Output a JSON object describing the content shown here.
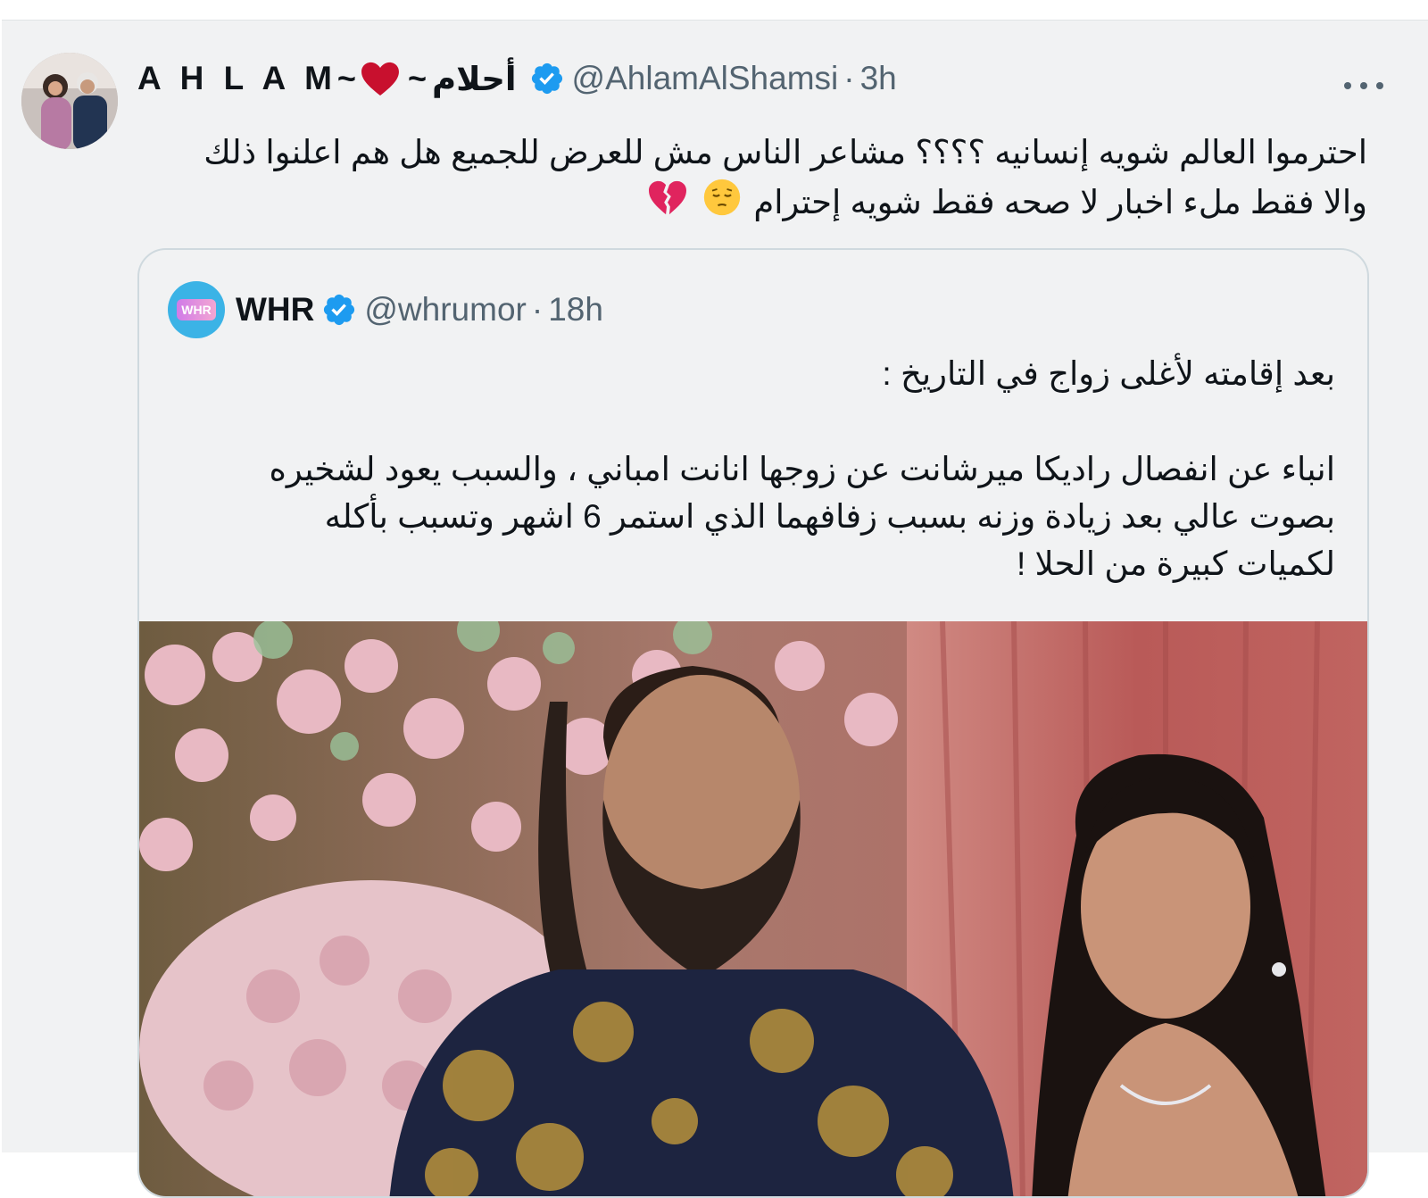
{
  "tweet": {
    "display_name": "A H L A M",
    "name_sep1": "~",
    "name_sep2": "~",
    "arabic_name": "أحلام",
    "handle": "@AhlamAlShamsi",
    "dot": "·",
    "time": "3h",
    "text_line1": "احترموا العالم شويه إنسانيه ؟؟؟؟ مشاعر  الناس مش للعرض للجميع هل هم اعلنوا ذلك",
    "text_line2": "والا فقط ملء اخبار لا صحه فقط شويه إحترام",
    "heart_icon": "red-heart-icon",
    "emoji1": "pensive-face-icon",
    "emoji2": "broken-heart-icon"
  },
  "quote": {
    "name": "WHR",
    "avatar_text": "WHR",
    "handle": "@whrumor",
    "dot": "·",
    "time": "18h",
    "line1": "بعد إقامته لأغلى زواج في التاريخ :",
    "line2": "انباء عن انفصال راديكا ميرشانت عن زوجها انانت امباني ، والسبب يعود لشخيره",
    "line3": "بصوت عالي بعد زيادة وزنه بسبب زفافهما الذي استمر 6 اشهر وتسبب بأكله",
    "line4": "لكميات كبيرة من الحلا !"
  },
  "colors": {
    "verified": "#1d9bf0",
    "secondary_text": "#536471",
    "heart": "#e0245e",
    "background": "#f1f2f3"
  }
}
